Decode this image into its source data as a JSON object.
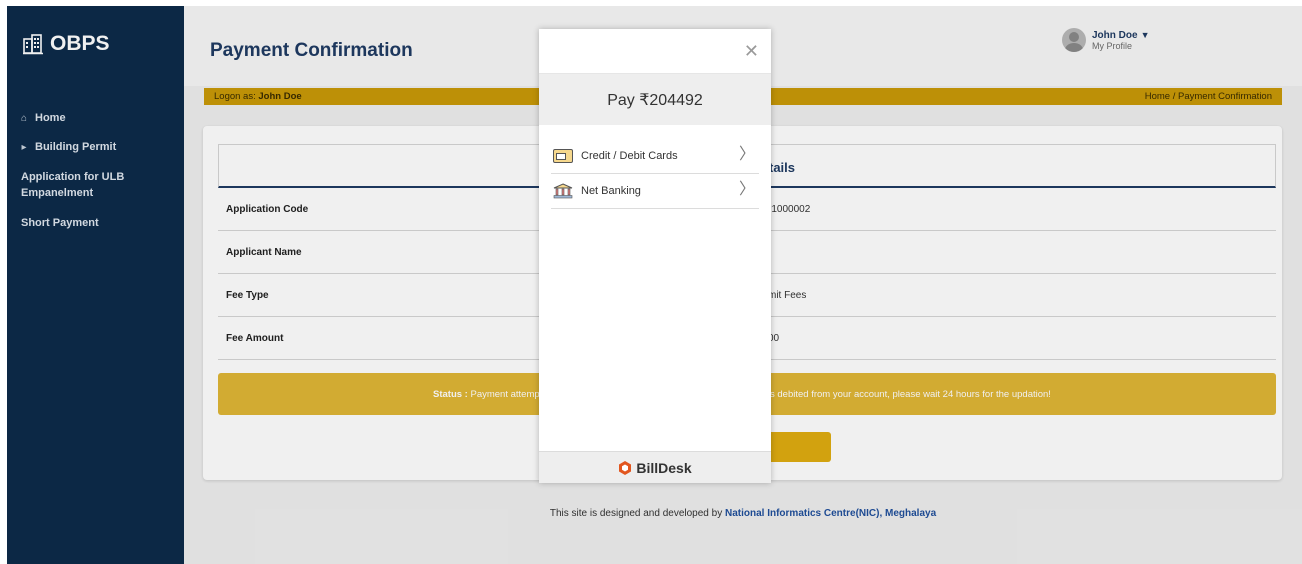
{
  "sidebar": {
    "brand": "OBPS",
    "items": [
      {
        "label": "Home"
      },
      {
        "label": "Building Permit"
      },
      {
        "label": "Application for ULB Empanelment"
      },
      {
        "label": "Short Payment"
      }
    ]
  },
  "header": {
    "title": "Payment Confirmation",
    "user_name": "John Doe",
    "user_sub": "My Profile"
  },
  "logon": {
    "prefix": "Logon as: ",
    "user": "John Doe",
    "breadcrumb": "Home  /  Payment Confirmation"
  },
  "details": {
    "title_fragment": "tails",
    "rows": [
      {
        "label": "Application Code",
        "value": "r1000002"
      },
      {
        "label": "Applicant Name",
        "value": ""
      },
      {
        "label": "Fee Type",
        "value": "mit Fees"
      },
      {
        "label": "Fee Amount",
        "value": "00"
      }
    ]
  },
  "status": {
    "label": "Status : ",
    "left_text": "Payment attempt",
    "right_text": "s debited from your account, please wait 24 hours for the updation!"
  },
  "footer": {
    "text": "This site is designed and developed by ",
    "link": "National Informatics Centre(NIC), Meghalaya"
  },
  "modal": {
    "close_glyph": "✕",
    "amount_text": "Pay ₹204492",
    "options": [
      {
        "label": "Credit / Debit Cards",
        "icon": "credit-card-icon"
      },
      {
        "label": "Net Banking",
        "icon": "bank-icon"
      }
    ],
    "footer_brand": "BillDesk",
    "brand_color": "#e2561f"
  },
  "colors": {
    "sidebar": "#0d2b4a",
    "accent_gold": "#c99a08",
    "title_blue": "#1f3b63"
  }
}
